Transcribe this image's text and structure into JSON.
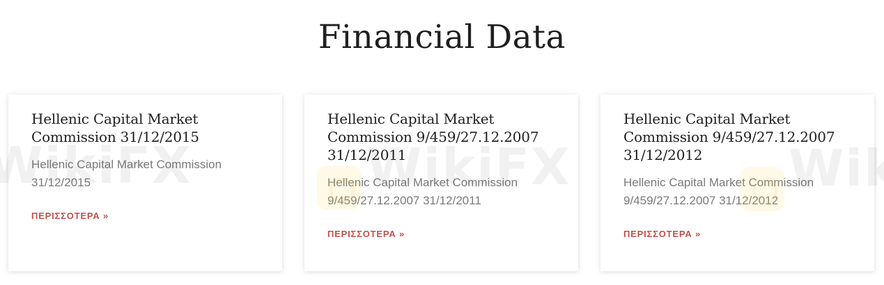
{
  "page": {
    "title": "Financial Data"
  },
  "watermark": {
    "text_left": "WikiFX",
    "text_center": "WikiFX",
    "text_right": "Wiki"
  },
  "cards": [
    {
      "title": "Hellenic Capital Market Commission 31/12/2015",
      "excerpt": "Hellenic Capital Market Commission 31/12/2015",
      "read_more": "ΠΕΡΙΣΣΟΤΕΡΑ »"
    },
    {
      "title": "Hellenic Capital Market Commission 9/459/27.12.2007 31/12/2011",
      "excerpt": "Hellenic Capital Market Commission 9/459/27.12.2007 31/12/2011",
      "read_more": "ΠΕΡΙΣΣΟΤΕΡΑ »"
    },
    {
      "title": "Hellenic Capital Market Commission 9/459/27.12.2007 31/12/2012",
      "excerpt": "Hellenic Capital Market Commission 9/459/27.12.2007 31/12/2012",
      "read_more": "ΠΕΡΙΣΣΟΤΕΡΑ »"
    }
  ]
}
